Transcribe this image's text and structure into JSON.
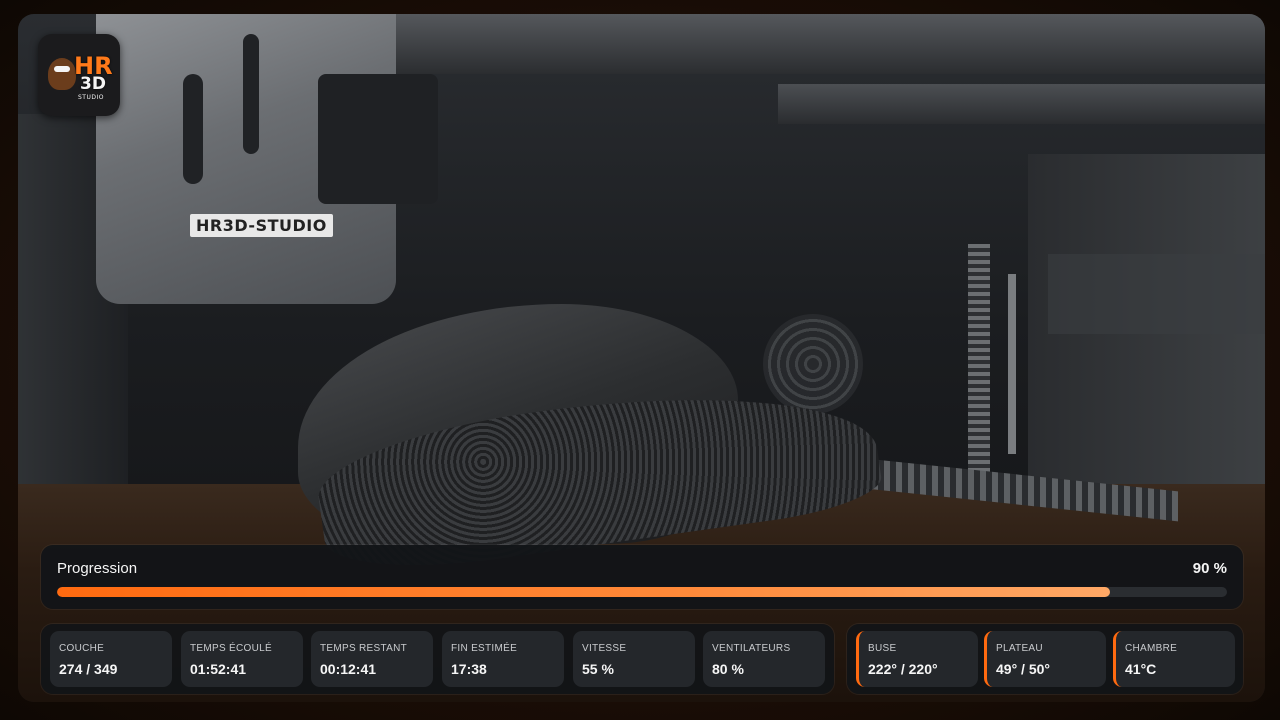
{
  "logo": {
    "line1": "HR",
    "line2": "3D",
    "line3": "STUDIO"
  },
  "scene": {
    "head_label": "HR3D-STUDIO"
  },
  "progress": {
    "title": "Progression",
    "value_text": "90 %",
    "fraction": 0.9,
    "color": "#ff6a10"
  },
  "stats": [
    {
      "label": "COUCHE",
      "value": "274 / 349"
    },
    {
      "label": "TEMPS ÉCOULÉ",
      "value": "01:52:41"
    },
    {
      "label": "TEMPS RESTANT",
      "value": "00:12:41"
    },
    {
      "label": "FIN ESTIMÉE",
      "value": "17:38"
    },
    {
      "label": "VITESSE",
      "value": "55 %"
    },
    {
      "label": "VENTILATEURS",
      "value": "80 %"
    }
  ],
  "temps": [
    {
      "label": "BUSE",
      "value": "222° / 220°"
    },
    {
      "label": "PLATEAU",
      "value": "49° / 50°"
    },
    {
      "label": "CHAMBRE",
      "value": "41°C"
    }
  ]
}
